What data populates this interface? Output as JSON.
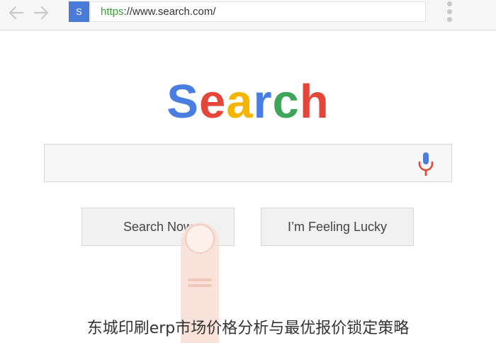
{
  "browser": {
    "favicon_letter": "S",
    "url_scheme": "https",
    "url_rest": "://www.search.com/"
  },
  "logo": {
    "letters": [
      {
        "char": "S",
        "color": "#4a7de0"
      },
      {
        "char": "e",
        "color": "#e4473a"
      },
      {
        "char": "a",
        "color": "#f5b400"
      },
      {
        "char": "r",
        "color": "#4a7de0"
      },
      {
        "char": "c",
        "color": "#3ea55a"
      },
      {
        "char": "h",
        "color": "#e4473a"
      }
    ]
  },
  "buttons": {
    "search_now": "Search Now",
    "feeling_lucky": "I’m Feeling Lucky"
  },
  "caption": "东城印刷erp市场价格分析与最优报价锁定策略"
}
